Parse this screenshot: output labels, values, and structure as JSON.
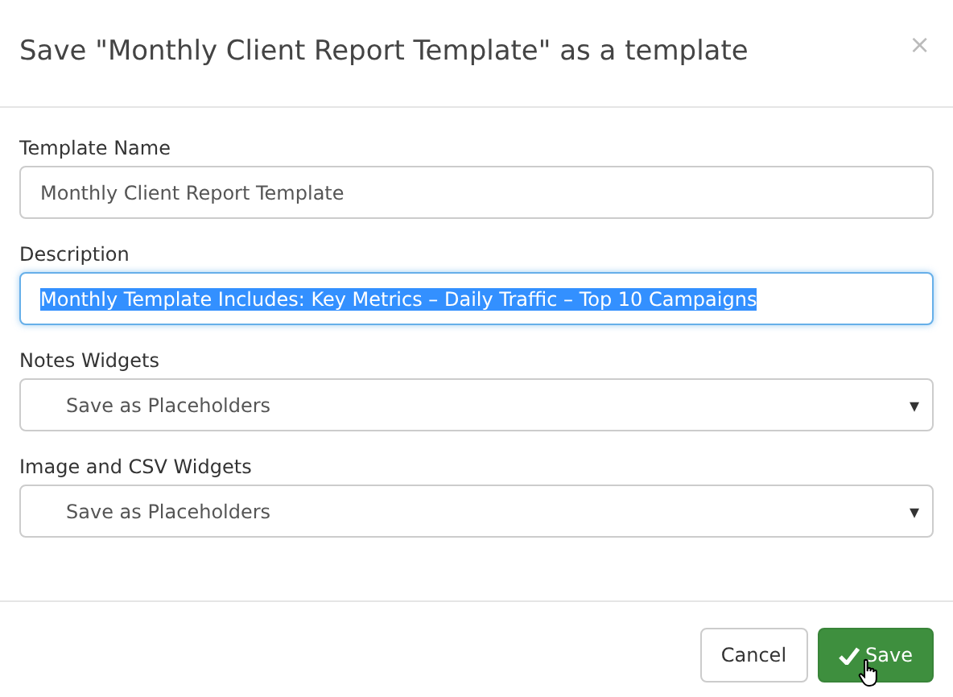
{
  "dialog": {
    "title": "Save \"Monthly Client Report Template\" as a template",
    "close": "×"
  },
  "fields": [
    {
      "kind": "text",
      "label": "Template Name",
      "value": "Monthly Client Report Template",
      "focused": false,
      "selected": false
    },
    {
      "kind": "text",
      "label": "Description",
      "value": "Monthly Template Includes: Key Metrics –  Daily Traffic –  Top 10 Campaigns",
      "focused": true,
      "selected": true
    },
    {
      "kind": "select",
      "label": "Notes Widgets",
      "value": "Save as Placeholders",
      "caret": "▾"
    },
    {
      "kind": "select",
      "label": "Image and CSV Widgets",
      "value": "Save as Placeholders",
      "caret": "▾"
    }
  ],
  "buttons": [
    {
      "label": "Cancel",
      "kind": "default",
      "icon": false
    },
    {
      "label": "Save",
      "kind": "primary",
      "icon": true,
      "hovered": true
    }
  ]
}
